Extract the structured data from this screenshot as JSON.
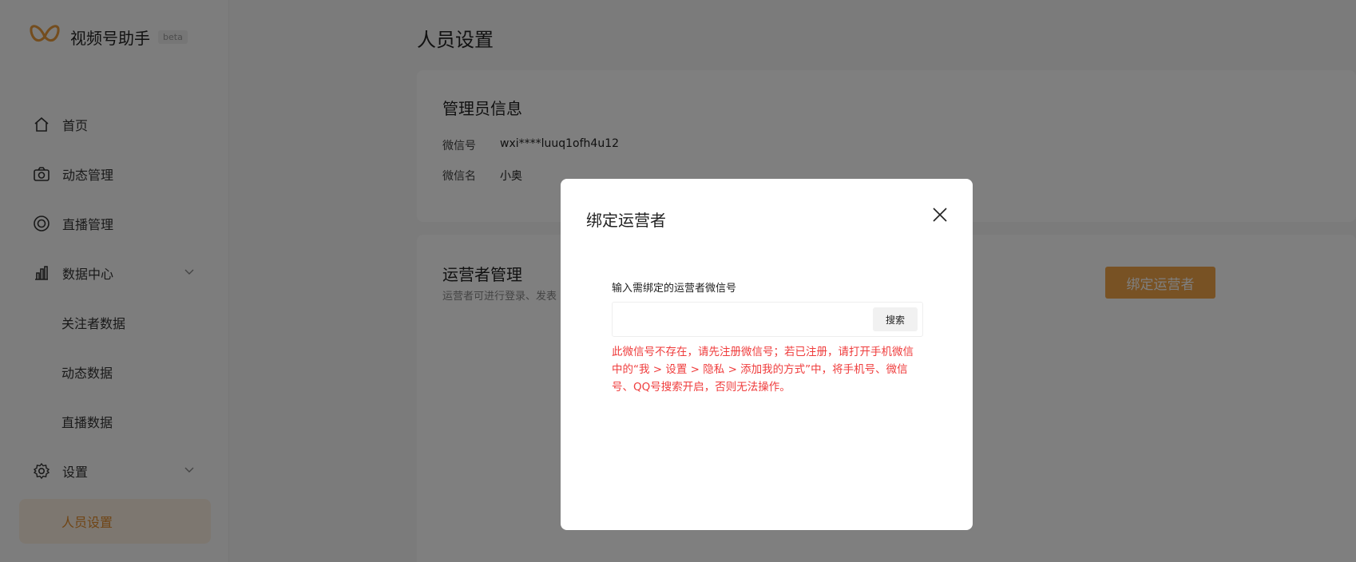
{
  "sidebar": {
    "app_name": "视频号助手",
    "beta_badge": "beta",
    "nav": [
      {
        "label": "首页"
      },
      {
        "label": "动态管理"
      },
      {
        "label": "直播管理"
      },
      {
        "label": "数据中心"
      },
      {
        "label": "关注者数据"
      },
      {
        "label": "动态数据"
      },
      {
        "label": "直播数据"
      },
      {
        "label": "设置"
      },
      {
        "label": "人员设置"
      }
    ]
  },
  "page": {
    "title": "人员设置"
  },
  "admin_card": {
    "title": "管理员信息",
    "wechat_id_label": "微信号",
    "wechat_id_value": "wxi****luuq1ofh4u12",
    "wechat_name_label": "微信名",
    "wechat_name_value": "小奥"
  },
  "operator_card": {
    "title": "运营者管理",
    "subtitle": "运营者可进行登录、发表",
    "bind_button": "绑定运营者"
  },
  "modal": {
    "title": "绑定运营者",
    "field_label": "输入需绑定的运营者微信号",
    "input_value": "",
    "search_button": "搜索",
    "error_message": "此微信号不存在，请先注册微信号；若已注册，请打开手机微信中的“我 > 设置 > 隐私 > 添加我的方式”中，将手机号、微信号、QQ号搜索开启，否则无法操作。"
  },
  "colors": {
    "accent": "#f0a548",
    "active_bg": "#fbeee0",
    "error": "#ef3c3c"
  }
}
